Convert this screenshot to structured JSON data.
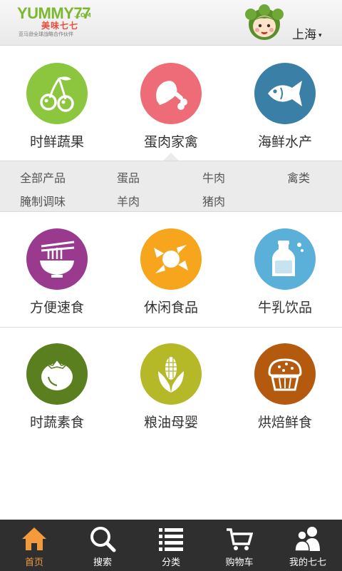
{
  "header": {
    "logo_main": "YUMMY77",
    "logo_domain": ".COM",
    "logo_cn": "美味七七",
    "logo_sub": "亚马逊全球战略合作伙伴",
    "city": "上海",
    "caret": "▾"
  },
  "categories_top": [
    {
      "label": "时鲜蔬果",
      "color": "#8cc63f",
      "icon": "cherry-icon"
    },
    {
      "label": "蛋肉家禽",
      "color": "#ee6b78",
      "icon": "chicken-leg-icon"
    },
    {
      "label": "海鲜水产",
      "color": "#3a7fa5",
      "icon": "fish-icon"
    }
  ],
  "submenu": {
    "row1": [
      "全部产品",
      "蛋品",
      "牛肉",
      "禽类"
    ],
    "row2": [
      "腌制调味",
      "羊肉",
      "猪肉"
    ]
  },
  "categories_mid": [
    {
      "label": "方便速食",
      "color": "#9a3a8f",
      "icon": "noodle-bowl-icon"
    },
    {
      "label": "休闲食品",
      "color": "#f7a51c",
      "icon": "candy-icon"
    },
    {
      "label": "牛乳饮品",
      "color": "#5ab0d8",
      "icon": "milk-bottle-icon"
    }
  ],
  "categories_bottom": [
    {
      "label": "时蔬素食",
      "color": "#5a7f1f",
      "icon": "tomato-icon"
    },
    {
      "label": "粮油母婴",
      "color": "#b5b827",
      "icon": "corn-icon"
    },
    {
      "label": "烘焙鲜食",
      "color": "#b35a0f",
      "icon": "muffin-icon"
    }
  ],
  "bottom_nav": [
    {
      "label": "首页",
      "icon": "home-icon",
      "active": true
    },
    {
      "label": "搜索",
      "icon": "search-icon",
      "active": false
    },
    {
      "label": "分类",
      "icon": "list-icon",
      "active": false
    },
    {
      "label": "购物车",
      "icon": "cart-icon",
      "active": false
    },
    {
      "label": "我的七七",
      "icon": "users-icon",
      "active": false
    }
  ],
  "colors": {
    "active_tab": "#f39a3d",
    "nav_bg": "#2f2f2f"
  }
}
